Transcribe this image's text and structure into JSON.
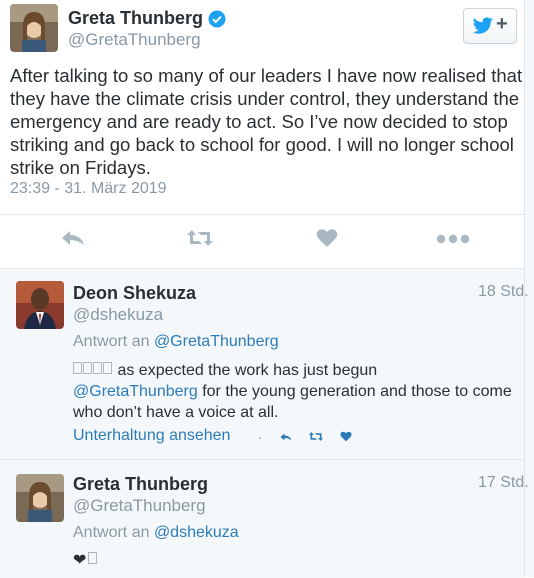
{
  "main_tweet": {
    "author_name": "Greta Thunberg",
    "author_handle": "@GretaThunberg",
    "verified": true,
    "follow_icon": "twitter-bird-follow",
    "follow_plus": "+",
    "text": "After talking to so many of our leaders I have now realised that they have the climate crisis under control, they understand the emergency and are ready to act. So I’ve now decided to stop striking and go back to school for good. I will no longer school strike on Fridays.",
    "timestamp": "23:39 - 31. März 2019",
    "actions": [
      "reply-icon",
      "retweet-icon",
      "like-icon",
      "more-icon"
    ]
  },
  "replies": [
    {
      "author_name": "Deon Shekuza",
      "author_handle": "@dshekuza",
      "time": "18 Std.",
      "reply_prefix": "Antwort an",
      "reply_to": "@GretaThunberg",
      "body_pre": "as expected the work has just begun",
      "body_mention": "@GretaThunberg",
      "body_post": " for the young generation and those to come who don’t have a voice at all.",
      "conversation_link": "Unterhaltung ansehen",
      "separator": "·"
    },
    {
      "author_name": "Greta Thunberg",
      "author_handle": "@GretaThunberg",
      "time": "17 Std.",
      "reply_prefix": "Antwort an",
      "reply_to": "@dshekuza",
      "body": "❤"
    }
  ],
  "colors": {
    "link": "#2b7bb9",
    "muted": "#8899a6",
    "verified": "#1da1f2",
    "reply_bg": "#f5f8fa"
  }
}
